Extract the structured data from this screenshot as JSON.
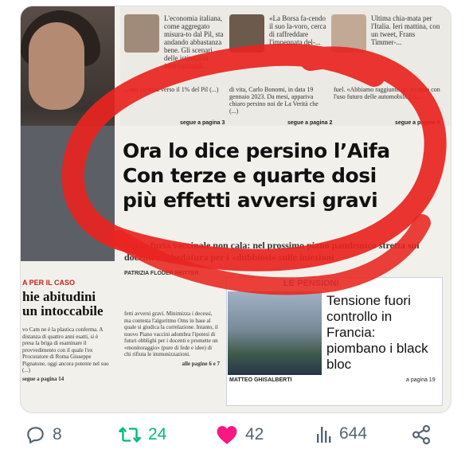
{
  "newspaper": {
    "col1_text": "L'economia italiana, come aggregato misura-to dal Pil, sta andando abbastanza bene. Gli scenari delle istituzioni internazionali...",
    "col2_text": "«La Borsa fa-cendo il suo la-voro, cerca di raffreddare l'impennata del-...",
    "col3_text": "Ultima chia-mata per l'Italia. Ieri mattina, con un tweet, Frans Timmer-...",
    "mid1_text": "...una crescita verso il 1% del Pil (...)",
    "mid1_more": "segue a pagina 3",
    "mid2_text": "di vita, Carlo Bonomi, in data 19 gennaio 2023. Da mesi, appariva chiaro persino noi de La Verità che (...)",
    "mid2_more": "segue a pagina 2",
    "mid3_text": "fuel. «Abbiamo raggiunto un accordo con l'uso futuro delle automobili. Lo...",
    "mid3_more": "segue a pagina 4",
    "headline_line1": "Ora lo dice persino l’Aifa",
    "headline_line2": "Con terze e quarte dosi",
    "headline_line3": "più effetti avversi gravi",
    "subhead": "Ma la furia vaccinale non cala: nel prossimo piano pandemico stretta sui docenti e schedatura per i «dubbiosi» sulle iniezioni",
    "byline": "PATRIZIA FLODER REITTER",
    "left_kicker": "A PER IL CASO",
    "left_title": "hie abitudini un intoccabile",
    "left_body": "vo Cam ne è la plastica conferma. A distanza di quattro anni esatti, si è presa la briga di esaminare il provvedimento con il quale l'ex Procuratore di Roma Giuseppe Pignatone, oggi ancora potente nel suo (...)",
    "left_more": "segue a pagina 14",
    "mid_bottom_body": "fetti avversi gravi. Minimizza i decessi, ma contesta l'algoritmo Oms in base al quale si giudica la correlazione. Intanto, il nuovo Piano vaccini adombra l'ipotesi di futuri obblighi per i docenti e promette un «monitoraggio» (pure di fede e idee) di chi rifiuta le immunizzazioni.",
    "mid_bottom_more": "alle pagine 6 e 7",
    "pensioni_kicker": "LE PENSIONI",
    "pensioni_title": "Tensione fuori controllo in Francia: piombano i black bloc",
    "pensioni_author": "MATTEO GHISALBERTI",
    "pensioni_page": "a pagina 19"
  },
  "actions": {
    "replies": "8",
    "reposts": "24",
    "likes": "42",
    "views": "644"
  },
  "colors": {
    "icon_gray": "#536471",
    "repost_green": "#00ba7c",
    "like_pink": "#f91880",
    "circle_red": "#e8241f"
  }
}
